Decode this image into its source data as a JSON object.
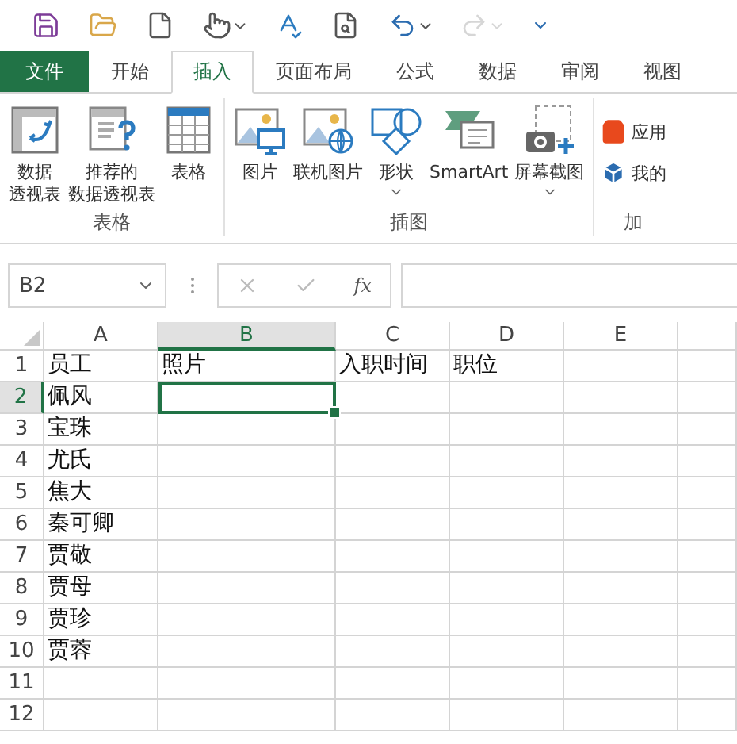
{
  "quick_access": [
    {
      "kind": "save",
      "has_menu": false,
      "disabled": false
    },
    {
      "kind": "open",
      "has_menu": false,
      "disabled": false
    },
    {
      "kind": "new",
      "has_menu": false,
      "disabled": false
    },
    {
      "kind": "touch",
      "has_menu": true,
      "disabled": false
    },
    {
      "kind": "spelling",
      "has_menu": false,
      "disabled": false
    },
    {
      "kind": "preview",
      "has_menu": false,
      "disabled": false
    },
    {
      "kind": "undo",
      "has_menu": true,
      "disabled": false
    },
    {
      "kind": "redo",
      "has_menu": true,
      "disabled": true
    },
    {
      "kind": "customize",
      "has_menu": false,
      "disabled": false
    }
  ],
  "tabs": [
    {
      "label": "文件",
      "kind": "file",
      "selected": false
    },
    {
      "label": "开始",
      "kind": "tab",
      "selected": false
    },
    {
      "label": "插入",
      "kind": "tab",
      "selected": true
    },
    {
      "label": "页面布局",
      "kind": "tab",
      "selected": false
    },
    {
      "label": "公式",
      "kind": "tab",
      "selected": false
    },
    {
      "label": "数据",
      "kind": "tab",
      "selected": false
    },
    {
      "label": "审阅",
      "kind": "tab",
      "selected": false
    },
    {
      "label": "视图",
      "kind": "tab",
      "selected": false
    }
  ],
  "ribbon_groups": [
    {
      "label": "表格",
      "kind": "large",
      "buttons": [
        {
          "lines": [
            "数据",
            "透视表"
          ],
          "kind": "pivot",
          "has_menu": false
        },
        {
          "lines": [
            "推荐的",
            "数据透视表"
          ],
          "kind": "recommended",
          "has_menu": false
        },
        {
          "lines": [
            "表格"
          ],
          "kind": "table",
          "has_menu": false
        }
      ]
    },
    {
      "label": "插图",
      "kind": "large",
      "buttons": [
        {
          "lines": [
            "图片"
          ],
          "kind": "picture",
          "has_menu": false
        },
        {
          "lines": [
            "联机图片"
          ],
          "kind": "online",
          "has_menu": false
        },
        {
          "lines": [
            "形状"
          ],
          "kind": "shapes",
          "has_menu": true
        },
        {
          "lines": [
            "SmartArt"
          ],
          "kind": "smartart",
          "has_menu": false
        },
        {
          "lines": [
            "屏幕截图"
          ],
          "kind": "screenshot",
          "has_menu": true
        }
      ]
    },
    {
      "label": "加",
      "kind": "small",
      "buttons": [
        {
          "lines": [
            "应用"
          ],
          "kind": "store"
        },
        {
          "lines": [
            "我的"
          ],
          "kind": "addins"
        }
      ]
    }
  ],
  "name_box": "B2",
  "function_label": "fx",
  "columns": [
    {
      "label": "A",
      "selected": false
    },
    {
      "label": "B",
      "selected": true
    },
    {
      "label": "C",
      "selected": false
    },
    {
      "label": "D",
      "selected": false
    },
    {
      "label": "E",
      "selected": false
    },
    {
      "selected": false
    }
  ],
  "rows": [
    {
      "number": "1",
      "selected": false,
      "cells": [
        "员工",
        "照片",
        "入职时间",
        "职位"
      ]
    },
    {
      "number": "2",
      "selected": true,
      "cells": [
        "佩风"
      ]
    },
    {
      "number": "3",
      "selected": false,
      "cells": [
        "宝珠"
      ]
    },
    {
      "number": "4",
      "selected": false,
      "cells": [
        "尤氏"
      ]
    },
    {
      "number": "5",
      "selected": false,
      "cells": [
        "焦大"
      ]
    },
    {
      "number": "6",
      "selected": false,
      "cells": [
        "秦可卿"
      ]
    },
    {
      "number": "7",
      "selected": false,
      "cells": [
        "贾敬"
      ]
    },
    {
      "number": "8",
      "selected": false,
      "cells": [
        "贾母"
      ]
    },
    {
      "number": "9",
      "selected": false,
      "cells": [
        "贾珍"
      ]
    },
    {
      "number": "10",
      "selected": false,
      "cells": [
        "贾蓉"
      ]
    },
    {
      "number": "11",
      "selected": false
    },
    {
      "number": "12",
      "selected": false
    }
  ]
}
